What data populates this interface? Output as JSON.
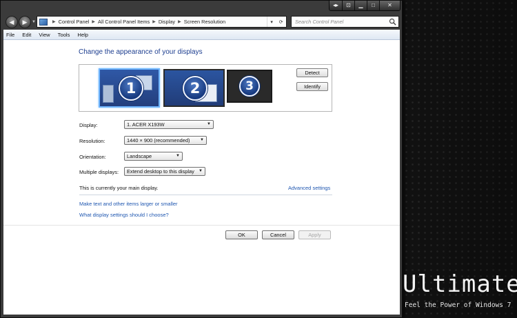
{
  "breadcrumb": [
    "Control Panel",
    "All Control Panel Items",
    "Display",
    "Screen Resolution"
  ],
  "search": {
    "placeholder": "Search Control Panel"
  },
  "menu": [
    "File",
    "Edit",
    "View",
    "Tools",
    "Help"
  ],
  "page": {
    "title": "Change the appearance of your displays"
  },
  "monitors": [
    "1",
    "2",
    "3"
  ],
  "buttons": {
    "detect": "Detect",
    "identify": "Identify",
    "ok": "OK",
    "cancel": "Cancel",
    "apply": "Apply"
  },
  "form": {
    "display_label": "Display:",
    "display_value": "1. ACER X193W",
    "resolution_label": "Resolution:",
    "resolution_value": "1440 × 900 (recommended)",
    "orientation_label": "Orientation:",
    "orientation_value": "Landscape",
    "multiple_label": "Multiple displays:",
    "multiple_value": "Extend desktop to this display"
  },
  "status": {
    "main_display": "This is currently your main display."
  },
  "links": {
    "advanced": "Advanced settings",
    "text_size": "Make text and other items larger or smaller",
    "which_settings": "What display settings should I choose?"
  },
  "branding": {
    "title": "Ultimate",
    "tagline": "Feel the Power of Windows 7"
  },
  "icons": {
    "back": "back-arrow-icon",
    "forward": "forward-arrow-icon",
    "search": "search-icon",
    "minimize": "minimize-icon",
    "maximize": "maximize-icon",
    "close": "close-icon",
    "restore": "restore-icon",
    "pin": "pin-icon"
  }
}
